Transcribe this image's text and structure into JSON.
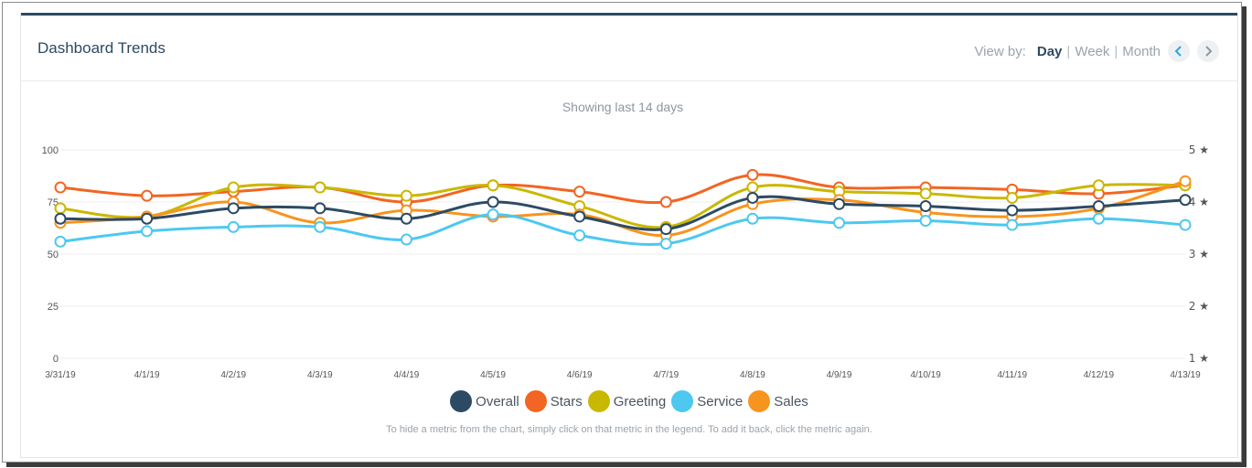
{
  "header": {
    "title": "Dashboard Trends",
    "view_by_label": "View by:",
    "options": [
      "Day",
      "Week",
      "Month"
    ],
    "active_option": "Day"
  },
  "chart_subtitle": "Showing last 14 days",
  "legend_hint": "To hide a metric from the chart, simply click on that metric in the legend. To add it back, click the metric again.",
  "colors": {
    "accent": "#2c4a63",
    "grid": "#ececec",
    "axis_text": "#555555"
  },
  "chart_data": {
    "type": "line",
    "smooth": true,
    "categories": [
      "3/31/19",
      "4/1/19",
      "4/2/19",
      "4/3/19",
      "4/4/19",
      "4/5/19",
      "4/6/19",
      "4/7/19",
      "4/8/19",
      "4/9/19",
      "4/10/19",
      "4/11/19",
      "4/12/19",
      "4/13/19"
    ],
    "y_left": {
      "ticks": [
        0,
        25,
        50,
        75,
        100
      ],
      "range": [
        0,
        100
      ]
    },
    "y_right": {
      "ticks": [
        1,
        2,
        3,
        4,
        5
      ],
      "suffix": "★",
      "range": [
        1,
        5
      ]
    },
    "grid": true,
    "legend_position": "bottom",
    "series": [
      {
        "name": "Stars",
        "color": "#f26522",
        "values": [
          82,
          78,
          80,
          82,
          75,
          83,
          80,
          75,
          88,
          82,
          82,
          81,
          79,
          83
        ]
      },
      {
        "name": "Greeting",
        "color": "#c9b800",
        "values": [
          72,
          68,
          82,
          82,
          78,
          83,
          73,
          63,
          82,
          80,
          79,
          77,
          83,
          83
        ]
      },
      {
        "name": "Sales",
        "color": "#f7941d",
        "values": [
          65,
          68,
          75,
          65,
          71,
          68,
          69,
          59,
          74,
          76,
          70,
          68,
          72,
          85
        ]
      },
      {
        "name": "Overall",
        "color": "#2c4a63",
        "values": [
          67,
          67,
          72,
          72,
          67,
          75,
          68,
          62,
          77,
          74,
          73,
          71,
          73,
          76
        ]
      },
      {
        "name": "Service",
        "color": "#4dc8f0",
        "values": [
          56,
          61,
          63,
          63,
          57,
          69,
          59,
          55,
          67,
          65,
          66,
          64,
          67,
          64
        ]
      }
    ],
    "legend_order": [
      "Overall",
      "Stars",
      "Greeting",
      "Service",
      "Sales"
    ]
  }
}
